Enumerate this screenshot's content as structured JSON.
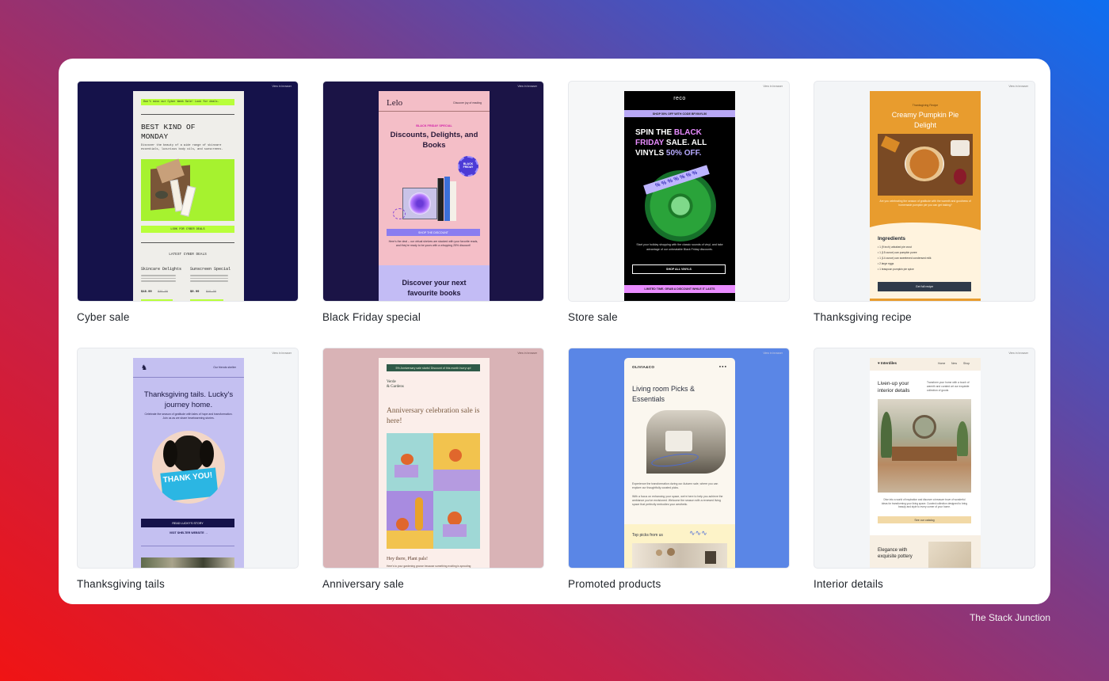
{
  "colors": {
    "panel": "#ffffff",
    "cyber_bg": "#15124a",
    "cyber_accent": "#b8ff3a",
    "bf_bg": "#1b1446",
    "bf_pink": "#f4bec7",
    "bf_lilac": "#c3bcf5",
    "store_black": "#000000",
    "store_pink": "#e98cff",
    "store_green": "#1f8a2c",
    "thanks_orange": "#e89c2e",
    "tails_lilac": "#c4c0f1",
    "anniv_rose": "#d9b3b6",
    "promo_blue": "#5a86e6",
    "interior_cream": "#f7efe3"
  },
  "templates": [
    {
      "label": "Cyber sale",
      "top_link": "View in browser",
      "banner": "Don't miss our Cyber Week Sale! Look for deals.",
      "headline": "BEST KIND OF MONDAY",
      "body": "Discover the beauty of a wide range of skincare essentials, luxurious body oils, and sunscreens.",
      "cta": "LOOK FOR CYBER DEALS",
      "section": "LATEST CYBER DEALS",
      "products": [
        {
          "name": "Skincare Delights",
          "price": "$18.99",
          "old": "$25.99"
        },
        {
          "name": "Sunscreen Special",
          "price": "$9.99",
          "old": "$15.99"
        }
      ]
    },
    {
      "label": "Black Friday special",
      "top_link": "View in browser",
      "logo": "Lelo",
      "nav": "Discover joy of reading",
      "eyebrow": "BLACK FRIDAY SPECIAL",
      "headline": "Discounts, Delights, and Books",
      "badge": "BLACK FRIDAY",
      "cta": "SHOP THE DISCOUNT",
      "body": "Here's the deal – our virtual shelves are stacked with your favorite reads, and they're ready to be yours with a whopping 25% discount!",
      "section": "Discover your next favourite books"
    },
    {
      "label": "Store sale",
      "top_link": "View in browser",
      "logo": "reco",
      "promo": "SHOP 50% OFF WITH CODE BFVINYL50",
      "headline_1": "SPIN THE ",
      "headline_2": "BLACK FRIDAY",
      "headline_3": " SALE. ALL VINYLS ",
      "headline_4": "50% OFF.",
      "tape": "% % % % % % %",
      "body": "Start your holiday shopping with the classic sounds of vinyl, and take advantage of our unbeatable Black Friday discounts.",
      "cta": "SHOP ALL VINYLS",
      "footer": "LIMITED TIME. GRAB A DISCOUNT WHILE IT LASTS"
    },
    {
      "label": "Thanksgiving recipe",
      "top_link": "View in browser",
      "eyebrow": "Thanksgiving Recipe",
      "headline": "Creamy Pumpkin Pie Delight",
      "body": "Are you celebrating the season of gratitude with the warmth and goodness of homemade pumpkin pie you can get baking?",
      "section": "Ingredients",
      "ingredients": [
        "1 (9 inch) unbaked pie crust",
        "1 (15 ounce) can pumpkin puree",
        "1 (14 ounce) can sweetened condensed milk",
        "2 large eggs",
        "1 teaspoon pumpkin pie spice"
      ],
      "cta": "Get full recipe"
    },
    {
      "label": "Thanksgiving tails",
      "top_link": "View in browser",
      "nav": "Our friends shelter",
      "headline": "Thanksgiving tails. Lucky's journey home.",
      "body": "Celebrate the season of gratitude with tales of hope and transformation. Join us as we share heartwarming stories.",
      "sign": "THANK YOU!",
      "cta": "READ LUCKY'S STORY",
      "link": "VISIT SHELTER WEBSITE →"
    },
    {
      "label": "Anniversary sale",
      "top_link": "View in browser",
      "banner": "5% Anniversary sale starts! Discount of this month hurry up!",
      "logo_1": "Verde",
      "logo_2": "& Gardens",
      "headline": "Anniversary celebration sale is here!",
      "greeting": "Hey there, Plant pals!",
      "body": "Here's to your gardening groove because something exciting is sprouting"
    },
    {
      "label": "Promoted products",
      "top_link": "View in browser",
      "logo": "OLIVIA&CO",
      "headline": "Living room Picks & Essentials",
      "body_1": "Experience the transformation during our Autumn sale, where you can explore our thoughtfully curated picks.",
      "body_2": "With a focus on enhancing your space, we're here to help you achieve the ambiance you've envisioned. Welcome the season with a renewed living space that perfectly embodies your aesthetic.",
      "section": "Top picks from us"
    },
    {
      "label": "Interior details",
      "top_link": "View in browser",
      "logo": "Interdiles",
      "nav": [
        "Home",
        "New",
        "Shop"
      ],
      "headline": "Liven-up your interior details",
      "intro": "Transform your home with a touch of warmth and curated art our exquisite collection of goods",
      "body": "Dive into a world of inspiration and discover a treasure trove of wonderful ideas for transforming your living space. Curated collection designed to bring beauty and style to every corner of your home.",
      "cta": "See our catalog",
      "section": "Elegance with exquisite pottery"
    }
  ],
  "footer": "The Stack Junction"
}
